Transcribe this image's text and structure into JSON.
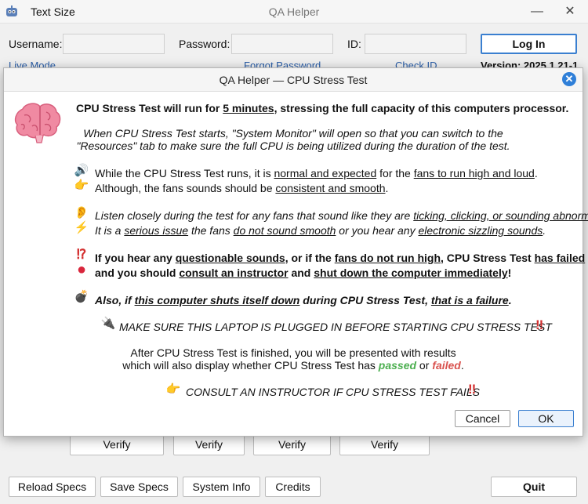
{
  "window": {
    "menu_text_size": "Text Size",
    "title": "QA Helper",
    "minimize_glyph": "—",
    "close_glyph": "✕"
  },
  "login": {
    "username_label": "Username:",
    "password_label": "Password:",
    "id_label": "ID:",
    "login_button": "Log In",
    "live_mode_link": "Live Mode",
    "forgot_password_link": "Forgot Password",
    "check_id_link": "Check ID",
    "version_text": "Version: 2025.1.21-1"
  },
  "verify_buttons": [
    "Verify",
    "Verify",
    "Verify",
    "Verify"
  ],
  "bottom": {
    "reload_specs": "Reload Specs",
    "save_specs": "Save Specs",
    "system_info": "System Info",
    "credits": "Credits",
    "quit": "Quit"
  },
  "dialog": {
    "title": "QA Helper  —  CPU Stress Test",
    "close_glyph": "✕",
    "headline": {
      "p1": "CPU Stress Test will run for ",
      "u1": "5 minutes",
      "p2": ", stressing the full capacity of this computers processor."
    },
    "intro_line1": "When CPU Stress Test starts, \"System Monitor\" will open so that you can switch to the",
    "intro_line2": "\"Resources\" tab to make sure the full CPU is being utilized during the duration of the test.",
    "fans_line1": {
      "p1": "While the CPU Stress Test runs, it is ",
      "u1": "normal and expected",
      "p2": " for the ",
      "u2": "fans to run high and loud",
      "p3": "."
    },
    "fans_line2": {
      "p1": "Although, the fans sounds should be ",
      "u1": "consistent and smooth",
      "p2": "."
    },
    "listen_line1": {
      "p1": "Listen closely during the test for any fans that sound like they are ",
      "u1": "ticking, clicking, or sounding abnormal",
      "p2": "."
    },
    "listen_line2": {
      "p1": "It is a ",
      "u1": "serious issue",
      "p2": " the fans ",
      "u2": "do not sound smooth",
      "p3": " or you hear any ",
      "u3": "electronic sizzling sounds",
      "p4": "."
    },
    "fail_line1": {
      "p1": "If you hear any ",
      "u1": "questionable sounds",
      "p2": ", or if the ",
      "u2": "fans do not run high",
      "p3": ", CPU Stress Test ",
      "u3": "has failed"
    },
    "fail_line2": {
      "p1": "and you should ",
      "u1": "consult an instructor",
      "p2": " and ",
      "u2": "shut down the computer immediately",
      "p3": "!"
    },
    "shutdown_line": {
      "p1": "Also, if ",
      "u1": "this computer shuts itself down",
      "p2": " during CPU Stress Test, ",
      "u2": "that is a failure",
      "p3": "."
    },
    "plug_line": "MAKE SURE THIS LAPTOP IS PLUGGED IN BEFORE STARTING CPU STRESS TEST",
    "after_line1": "After CPU Stress Test is finished, you will be presented with results",
    "after_line2": {
      "p1": "which will also display whether CPU Stress Test has ",
      "passed": "passed",
      "p2": " or ",
      "failed": "failed",
      "p3": "."
    },
    "consult_line": "CONSULT AN INSTRUCTOR IF CPU STRESS TEST FAILS",
    "bangs": "‼",
    "cancel_button": "Cancel",
    "ok_button": "OK",
    "emoji": {
      "speaker": "🔊",
      "pointing_hand": "👉",
      "ear": "👂",
      "lightning": "⚡",
      "interrobang": "⁉",
      "red_circle": "●",
      "bomb": "💣",
      "plug": "🔌"
    }
  },
  "colors": {
    "accent": "#2f7fd8",
    "passed": "#4caf50",
    "failed": "#d9534f",
    "alarm": "#d32f2f"
  }
}
